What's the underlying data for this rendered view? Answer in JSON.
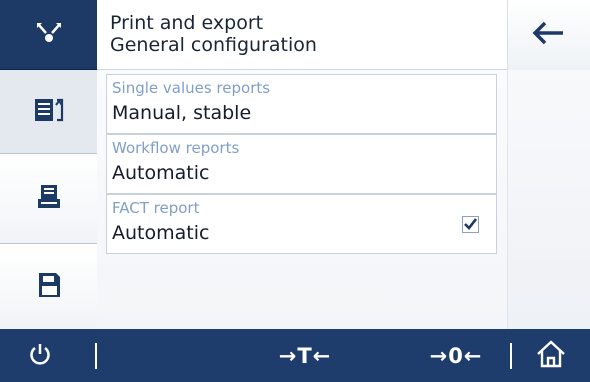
{
  "header": {
    "title": "Print and export",
    "subtitle": "General configuration"
  },
  "sidebar": {
    "items": [
      {
        "icon": "network-icon",
        "state": "dark"
      },
      {
        "icon": "report-icon",
        "state": "active"
      },
      {
        "icon": "printer-icon",
        "state": "normal"
      },
      {
        "icon": "save-icon",
        "state": "normal"
      }
    ]
  },
  "settings": [
    {
      "label": "Single values reports",
      "value": "Manual, stable"
    },
    {
      "label": "Workflow reports",
      "value": "Automatic"
    },
    {
      "label": "FACT report",
      "value": "Automatic",
      "checked": true
    }
  ],
  "bottom_bar": {
    "tare_label": "→T←",
    "zero_label": "→0←",
    "icons": [
      "power-icon",
      "home-icon"
    ]
  },
  "colors": {
    "dark_blue": "#1e3d6c",
    "label_blue": "#7f9fca",
    "accent_arrow": "#1d3a66"
  }
}
